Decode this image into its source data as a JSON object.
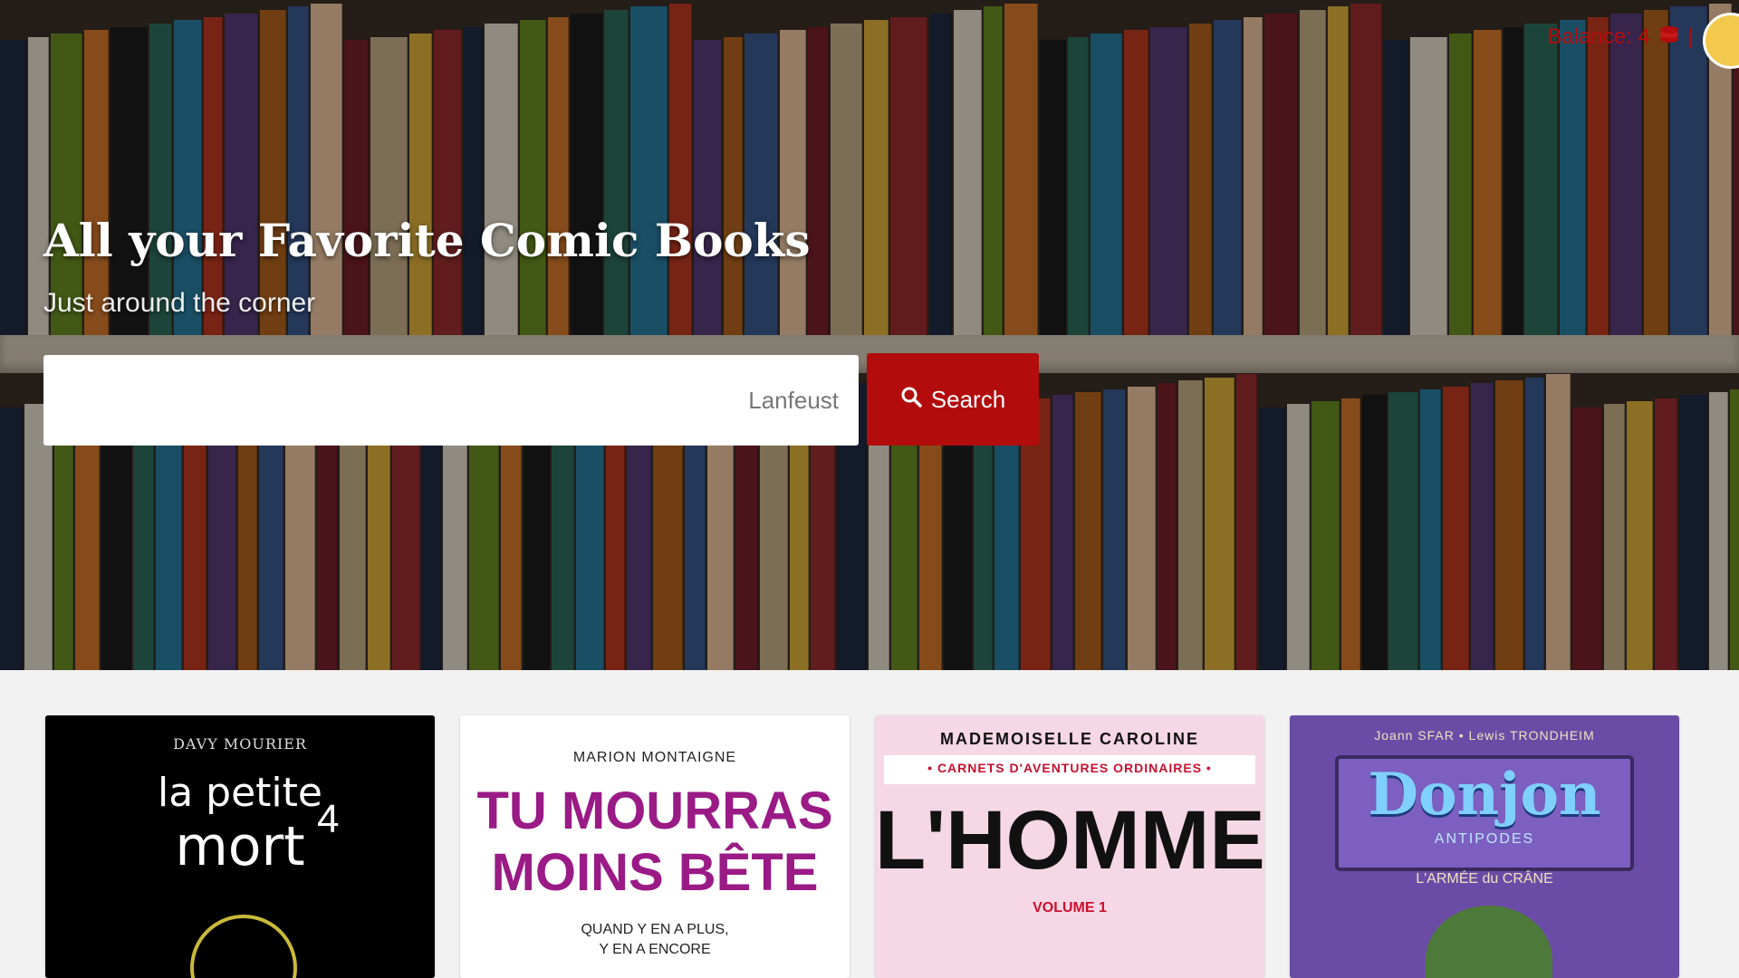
{
  "hero": {
    "title": "All your Favorite Comic Books",
    "subtitle": "Just around the corner"
  },
  "search": {
    "placeholder": "Lanfeust",
    "button_label": "Search",
    "button_icon": "search-icon"
  },
  "header": {
    "balance_label": "Balance: 4",
    "balance_icon": "coins-icon",
    "avatar_icon": "user-avatar"
  },
  "colors": {
    "accent": "#b20c0c"
  },
  "books": [
    {
      "author": "DAVY MOURIER",
      "title_line1": "la petite",
      "title_line2": "mort",
      "volume": "4"
    },
    {
      "author": "MARION MONTAIGNE",
      "title_line1": "TU MOURRAS",
      "title_line2": "MOINS BÊTE",
      "subtitle_line1": "QUAND Y EN A PLUS,",
      "subtitle_line2": "Y EN A ENCORE"
    },
    {
      "author": "MADEMOISELLE CAROLINE",
      "series": "• CARNETS D'AVENTURES ORDINAIRES •",
      "title": "L'HOMME",
      "volume_label": "VOLUME 1"
    },
    {
      "author": "Joann SFAR • Lewis TRONDHEIM",
      "title": "Donjon",
      "series": "ANTIPODES",
      "subtitle": "L'ARMÉE du CRÂNE"
    }
  ]
}
